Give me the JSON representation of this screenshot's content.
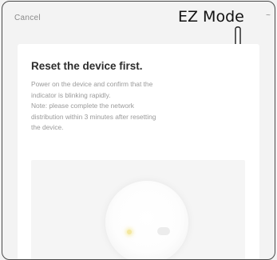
{
  "header": {
    "cancel_label": "Cancel",
    "mode_label": "EZ Mode",
    "mode_caret": "~"
  },
  "card": {
    "title": "Reset the device first.",
    "description_lines": [
      "Power on the device and confirm that the",
      "indicator is blinking rapidly.",
      "Note: please complete the network",
      "distribution within 3 minutes after resetting",
      "the device."
    ]
  },
  "icons": {
    "hand": "pointing-hand-icon",
    "caret": "chevron-down-icon",
    "led": "indicator-light-icon"
  },
  "colors": {
    "background": "#f3f3f3",
    "card": "#ffffff",
    "title": "#2d2d2d",
    "muted_text": "#9a9a9a",
    "led": "#f3e7a0"
  }
}
